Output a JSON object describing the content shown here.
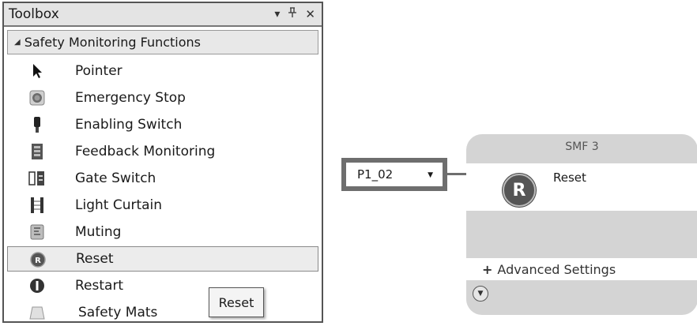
{
  "toolbox": {
    "title": "Toolbox",
    "controls": {
      "dropdown": "▾",
      "pin": "⊥",
      "close": "✕"
    },
    "category": "Safety Monitoring Functions",
    "items": [
      {
        "label": "Pointer",
        "icon": "pointer-icon"
      },
      {
        "label": "Emergency Stop",
        "icon": "emergency-stop-icon"
      },
      {
        "label": "Enabling Switch",
        "icon": "enabling-switch-icon"
      },
      {
        "label": "Feedback Monitoring",
        "icon": "feedback-monitoring-icon"
      },
      {
        "label": "Gate Switch",
        "icon": "gate-switch-icon"
      },
      {
        "label": "Light Curtain",
        "icon": "light-curtain-icon"
      },
      {
        "label": "Muting",
        "icon": "muting-icon"
      },
      {
        "label": "Reset",
        "icon": "reset-icon",
        "selected": true
      },
      {
        "label": "Restart",
        "icon": "restart-icon"
      },
      {
        "label": "Safety Mats",
        "icon": "safety-mats-icon"
      }
    ],
    "tooltip": "Reset"
  },
  "canvas": {
    "input": {
      "value": "P1_02"
    },
    "smf": {
      "title": "SMF 3",
      "icon_letter": "R",
      "label": "Reset",
      "advanced_settings": "Advanced Settings"
    }
  }
}
